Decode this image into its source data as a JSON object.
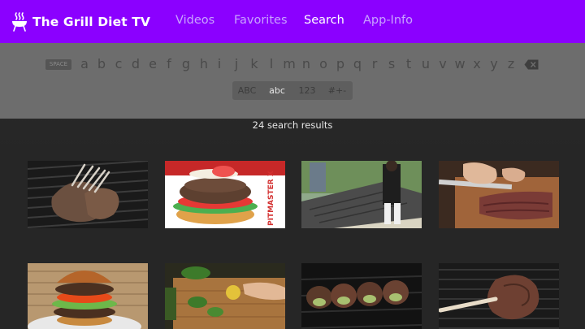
{
  "app": {
    "title": "The Grill Diet TV",
    "accent_color": "#8b00ff",
    "logo_icon": "grill-icon"
  },
  "nav": {
    "items": [
      {
        "label": "Videos",
        "active": false
      },
      {
        "label": "Favorites",
        "active": false
      },
      {
        "label": "Search",
        "active": true
      },
      {
        "label": "App-Info",
        "active": false
      }
    ]
  },
  "keyboard": {
    "space_label": "SPACE",
    "letters": [
      "a",
      "b",
      "c",
      "d",
      "e",
      "f",
      "g",
      "h",
      "i",
      "j",
      "k",
      "l",
      "m",
      "n",
      "o",
      "p",
      "q",
      "r",
      "s",
      "t",
      "u",
      "v",
      "w",
      "x",
      "y",
      "z"
    ],
    "delete_icon": "backspace-icon",
    "modes": [
      {
        "label": "ABC",
        "selected": false
      },
      {
        "label": "abc",
        "selected": true
      },
      {
        "label": "123",
        "selected": false
      },
      {
        "label": "#+-",
        "selected": false
      }
    ]
  },
  "results": {
    "count_text": "24 search results",
    "thumbnails": [
      {
        "subject": "lamb rack on grill"
      },
      {
        "subject": "burger",
        "overlay_text": "PITMASTER X"
      },
      {
        "subject": "outdoor grilling"
      },
      {
        "subject": "sliced steak on cutting board"
      },
      {
        "subject": "stacked burger"
      },
      {
        "subject": "herbs and oil preparation"
      },
      {
        "subject": "stuffed wraps on grill"
      },
      {
        "subject": "tomahawk steak on grill"
      }
    ]
  }
}
